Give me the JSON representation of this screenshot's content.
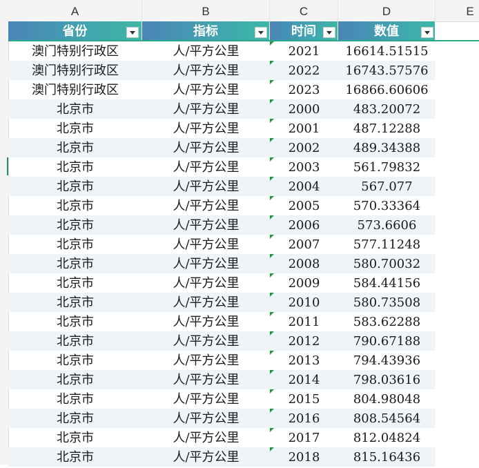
{
  "column_letters": [
    "A",
    "B",
    "C",
    "D",
    "E"
  ],
  "headers": [
    "省份",
    "指标",
    "时间",
    "数值"
  ],
  "rows": [
    [
      "澳门特别行政区",
      "人/平方公里",
      "2021",
      "16614.51515"
    ],
    [
      "澳门特别行政区",
      "人/平方公里",
      "2022",
      "16743.57576"
    ],
    [
      "澳门特别行政区",
      "人/平方公里",
      "2023",
      "16866.60606"
    ],
    [
      "北京市",
      "人/平方公里",
      "2000",
      "483.20072"
    ],
    [
      "北京市",
      "人/平方公里",
      "2001",
      "487.12288"
    ],
    [
      "北京市",
      "人/平方公里",
      "2002",
      "489.34388"
    ],
    [
      "北京市",
      "人/平方公里",
      "2003",
      "561.79832"
    ],
    [
      "北京市",
      "人/平方公里",
      "2004",
      "567.077"
    ],
    [
      "北京市",
      "人/平方公里",
      "2005",
      "570.33364"
    ],
    [
      "北京市",
      "人/平方公里",
      "2006",
      "573.6606"
    ],
    [
      "北京市",
      "人/平方公里",
      "2007",
      "577.11248"
    ],
    [
      "北京市",
      "人/平方公里",
      "2008",
      "580.70032"
    ],
    [
      "北京市",
      "人/平方公里",
      "2009",
      "584.44156"
    ],
    [
      "北京市",
      "人/平方公里",
      "2010",
      "580.73508"
    ],
    [
      "北京市",
      "人/平方公里",
      "2011",
      "583.62288"
    ],
    [
      "北京市",
      "人/平方公里",
      "2012",
      "790.67188"
    ],
    [
      "北京市",
      "人/平方公里",
      "2013",
      "794.43936"
    ],
    [
      "北京市",
      "人/平方公里",
      "2014",
      "798.03616"
    ],
    [
      "北京市",
      "人/平方公里",
      "2015",
      "804.98048"
    ],
    [
      "北京市",
      "人/平方公里",
      "2016",
      "808.54564"
    ],
    [
      "北京市",
      "人/平方公里",
      "2017",
      "812.04824"
    ],
    [
      "北京市",
      "人/平方公里",
      "2018",
      "815.16436"
    ]
  ],
  "colors": {
    "header_gradient_start": "#4a84b6",
    "header_gradient_end": "#3cb8a6",
    "band_row": "#eef4f8",
    "number_as_text_marker": "#1f9a3c"
  },
  "icons": {
    "filter_dropdown": "chevron-down-icon",
    "number_as_text_marker": "green-triangle-icon"
  }
}
